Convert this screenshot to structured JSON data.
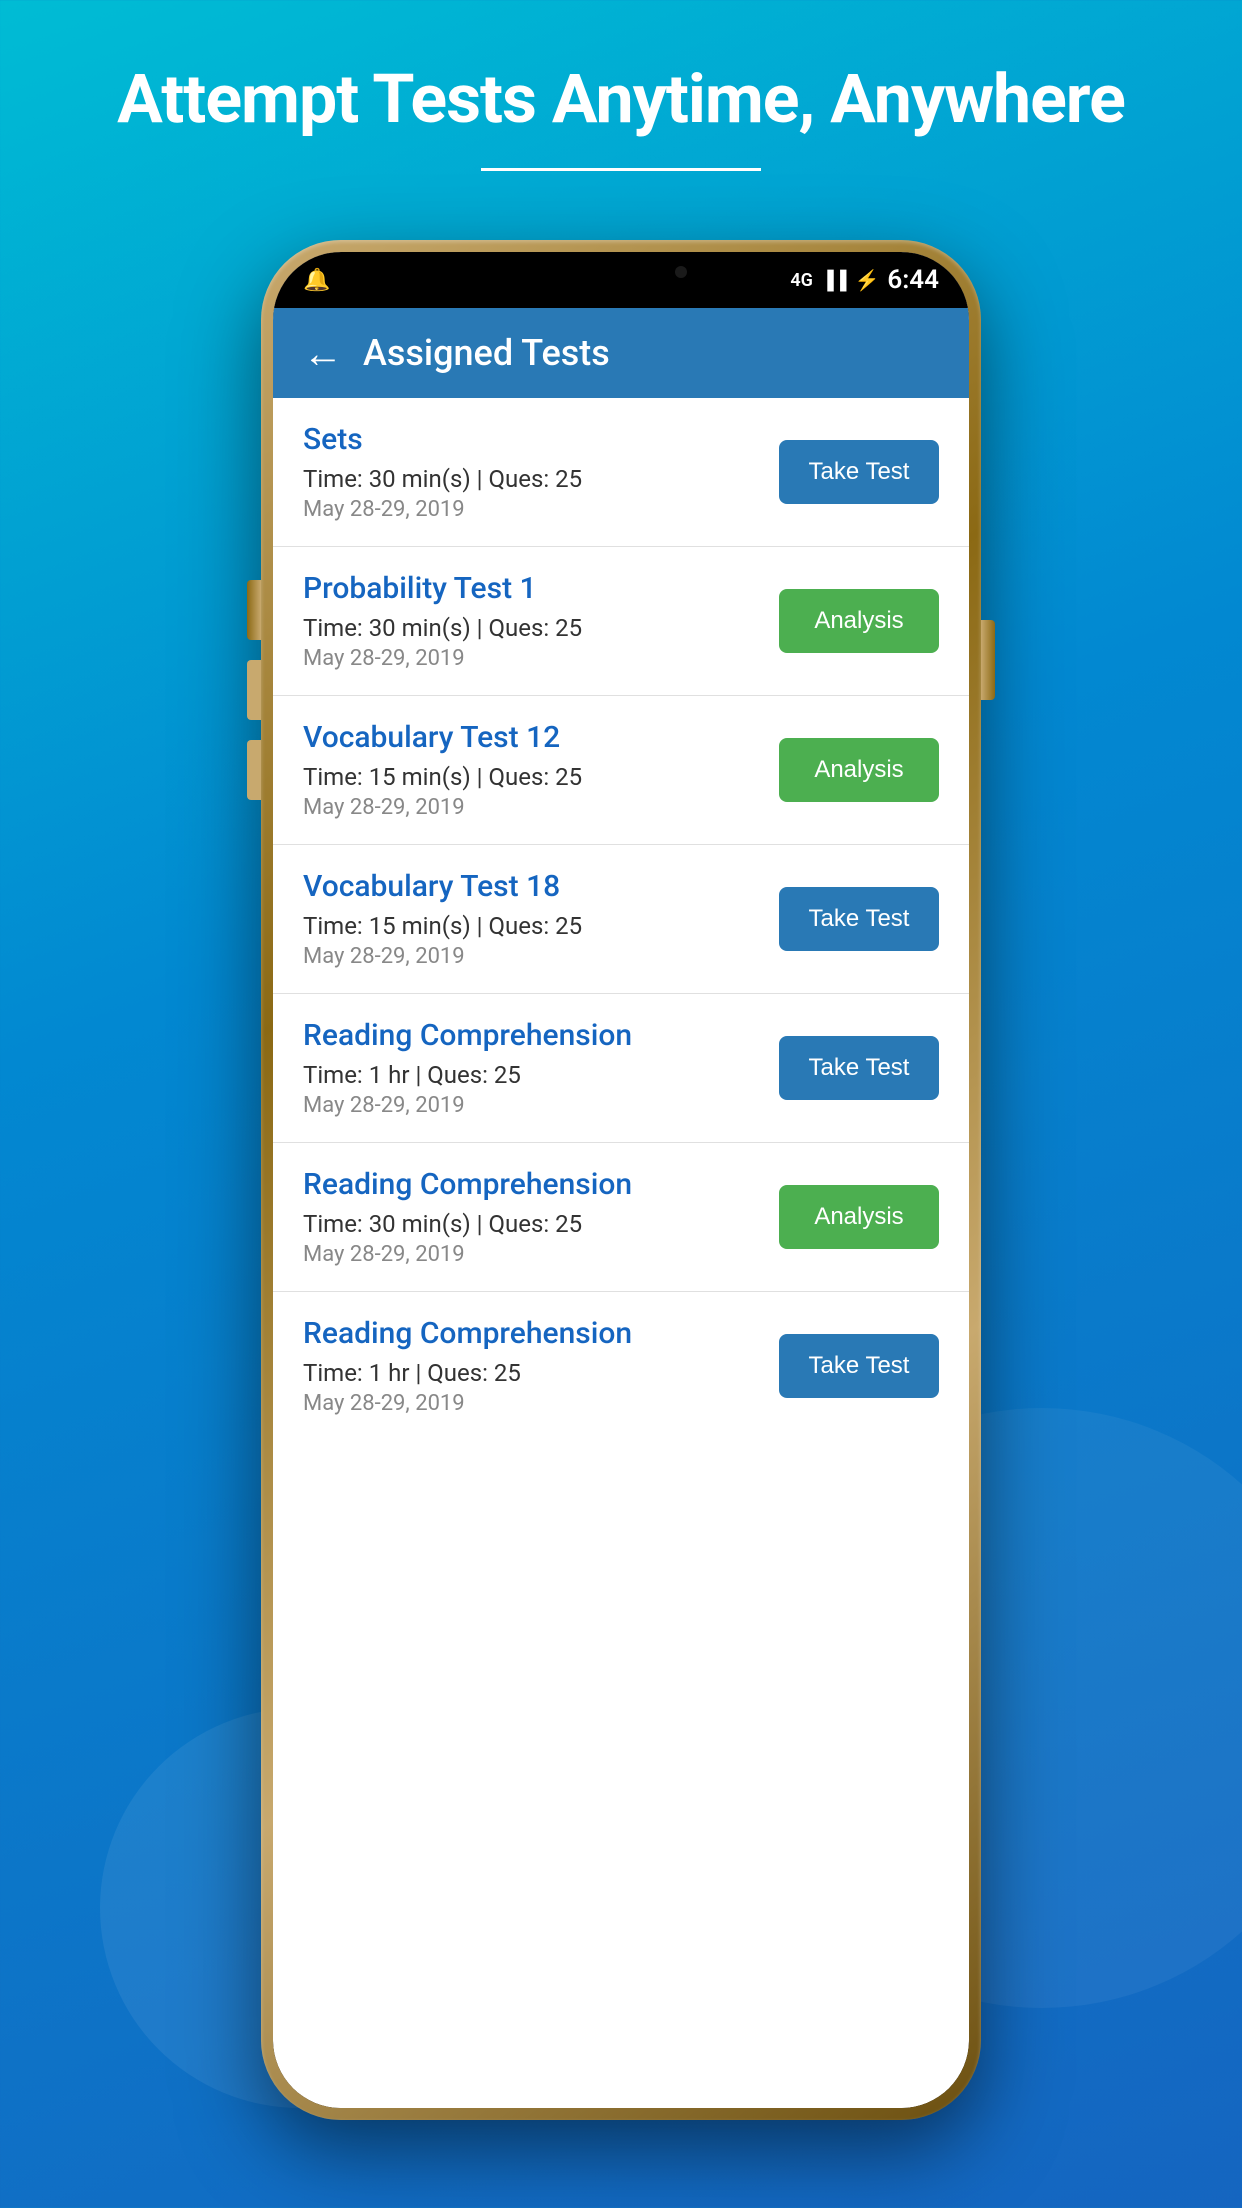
{
  "page": {
    "background_title": "Attempt Tests Anytime, Anywhere"
  },
  "status_bar": {
    "time": "6:44",
    "network": "4G",
    "icons": {
      "signal": "signal-icon",
      "battery": "battery-icon",
      "notification": "notification-icon"
    }
  },
  "app_header": {
    "title": "Assigned Tests",
    "back_label": "←"
  },
  "tests": [
    {
      "id": 1,
      "name": "Sets",
      "time": "Time: 30 min(s) | Ques: 25",
      "date": "May 28-29, 2019",
      "button_type": "take_test",
      "button_label": "Take Test"
    },
    {
      "id": 2,
      "name": "Probability Test 1",
      "time": "Time: 30 min(s) | Ques: 25",
      "date": "May 28-29, 2019",
      "button_type": "analysis",
      "button_label": "Analysis"
    },
    {
      "id": 3,
      "name": "Vocabulary Test 12",
      "time": "Time: 15 min(s) | Ques: 25",
      "date": "May 28-29, 2019",
      "button_type": "analysis",
      "button_label": "Analysis"
    },
    {
      "id": 4,
      "name": "Vocabulary Test 18",
      "time": "Time: 15 min(s) | Ques: 25",
      "date": "May 28-29, 2019",
      "button_type": "take_test",
      "button_label": "Take Test"
    },
    {
      "id": 5,
      "name": "Reading Comprehension",
      "time": "Time: 1 hr | Ques: 25",
      "date": "May 28-29, 2019",
      "button_type": "take_test",
      "button_label": "Take Test"
    },
    {
      "id": 6,
      "name": "Reading Comprehension",
      "time": "Time: 30 min(s) | Ques: 25",
      "date": "May 28-29, 2019",
      "button_type": "analysis",
      "button_label": "Analysis"
    },
    {
      "id": 7,
      "name": "Reading Comprehension",
      "time": "Time: 1 hr | Ques: 25",
      "date": "May 28-29, 2019",
      "button_type": "take_test",
      "button_label": "Take Test"
    }
  ]
}
